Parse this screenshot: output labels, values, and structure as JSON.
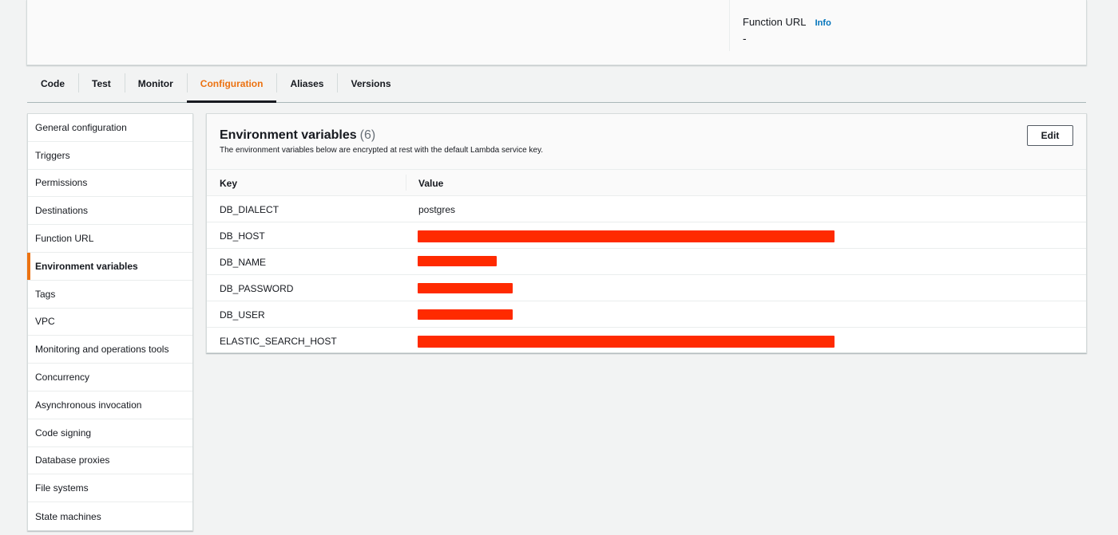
{
  "header": {
    "function_url_label": "Function URL",
    "info_link": "Info",
    "function_url_value": "-"
  },
  "tabs": [
    {
      "label": "Code"
    },
    {
      "label": "Test"
    },
    {
      "label": "Monitor"
    },
    {
      "label": "Configuration",
      "active": true
    },
    {
      "label": "Aliases"
    },
    {
      "label": "Versions"
    }
  ],
  "sidebar": {
    "items": [
      {
        "label": "General configuration"
      },
      {
        "label": "Triggers"
      },
      {
        "label": "Permissions"
      },
      {
        "label": "Destinations"
      },
      {
        "label": "Function URL"
      },
      {
        "label": "Environment variables",
        "active": true
      },
      {
        "label": "Tags"
      },
      {
        "label": "VPC"
      },
      {
        "label": "Monitoring and operations tools"
      },
      {
        "label": "Concurrency"
      },
      {
        "label": "Asynchronous invocation"
      },
      {
        "label": "Code signing"
      },
      {
        "label": "Database proxies"
      },
      {
        "label": "File systems"
      },
      {
        "label": "State machines"
      }
    ]
  },
  "env_panel": {
    "title": "Environment variables",
    "count": "(6)",
    "description": "The environment variables below are encrypted at rest with the default Lambda service key.",
    "edit_label": "Edit",
    "columns": {
      "key": "Key",
      "value": "Value"
    },
    "rows": [
      {
        "key": "DB_DIALECT",
        "value": "postgres",
        "redacted": false
      },
      {
        "key": "DB_HOST",
        "value": "",
        "redacted": true
      },
      {
        "key": "DB_NAME",
        "value": "",
        "redacted": true
      },
      {
        "key": "DB_PASSWORD",
        "value": "",
        "redacted": true
      },
      {
        "key": "DB_USER",
        "value": "",
        "redacted": true
      },
      {
        "key": "ELASTIC_SEARCH_HOST",
        "value": "",
        "redacted": true
      }
    ]
  },
  "colors": {
    "accent_orange": "#ec7211",
    "link_blue": "#0073bb",
    "redaction_red": "#ff2a00",
    "page_bg": "#f2f3f3"
  }
}
